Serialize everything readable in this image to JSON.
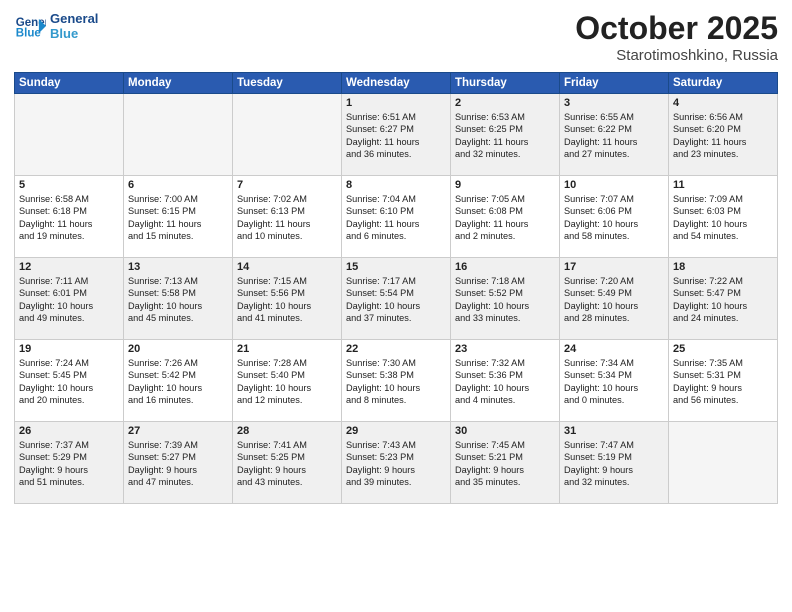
{
  "header": {
    "logo_line1": "General",
    "logo_line2": "Blue",
    "month": "October 2025",
    "location": "Starotimoshkino, Russia"
  },
  "days_of_week": [
    "Sunday",
    "Monday",
    "Tuesday",
    "Wednesday",
    "Thursday",
    "Friday",
    "Saturday"
  ],
  "weeks": [
    [
      {
        "day": "",
        "info": "",
        "empty": true
      },
      {
        "day": "",
        "info": "",
        "empty": true
      },
      {
        "day": "",
        "info": "",
        "empty": true
      },
      {
        "day": "1",
        "info": "Sunrise: 6:51 AM\nSunset: 6:27 PM\nDaylight: 11 hours\nand 36 minutes."
      },
      {
        "day": "2",
        "info": "Sunrise: 6:53 AM\nSunset: 6:25 PM\nDaylight: 11 hours\nand 32 minutes."
      },
      {
        "day": "3",
        "info": "Sunrise: 6:55 AM\nSunset: 6:22 PM\nDaylight: 11 hours\nand 27 minutes."
      },
      {
        "day": "4",
        "info": "Sunrise: 6:56 AM\nSunset: 6:20 PM\nDaylight: 11 hours\nand 23 minutes."
      }
    ],
    [
      {
        "day": "5",
        "info": "Sunrise: 6:58 AM\nSunset: 6:18 PM\nDaylight: 11 hours\nand 19 minutes."
      },
      {
        "day": "6",
        "info": "Sunrise: 7:00 AM\nSunset: 6:15 PM\nDaylight: 11 hours\nand 15 minutes."
      },
      {
        "day": "7",
        "info": "Sunrise: 7:02 AM\nSunset: 6:13 PM\nDaylight: 11 hours\nand 10 minutes."
      },
      {
        "day": "8",
        "info": "Sunrise: 7:04 AM\nSunset: 6:10 PM\nDaylight: 11 hours\nand 6 minutes."
      },
      {
        "day": "9",
        "info": "Sunrise: 7:05 AM\nSunset: 6:08 PM\nDaylight: 11 hours\nand 2 minutes."
      },
      {
        "day": "10",
        "info": "Sunrise: 7:07 AM\nSunset: 6:06 PM\nDaylight: 10 hours\nand 58 minutes."
      },
      {
        "day": "11",
        "info": "Sunrise: 7:09 AM\nSunset: 6:03 PM\nDaylight: 10 hours\nand 54 minutes."
      }
    ],
    [
      {
        "day": "12",
        "info": "Sunrise: 7:11 AM\nSunset: 6:01 PM\nDaylight: 10 hours\nand 49 minutes."
      },
      {
        "day": "13",
        "info": "Sunrise: 7:13 AM\nSunset: 5:58 PM\nDaylight: 10 hours\nand 45 minutes."
      },
      {
        "day": "14",
        "info": "Sunrise: 7:15 AM\nSunset: 5:56 PM\nDaylight: 10 hours\nand 41 minutes."
      },
      {
        "day": "15",
        "info": "Sunrise: 7:17 AM\nSunset: 5:54 PM\nDaylight: 10 hours\nand 37 minutes."
      },
      {
        "day": "16",
        "info": "Sunrise: 7:18 AM\nSunset: 5:52 PM\nDaylight: 10 hours\nand 33 minutes."
      },
      {
        "day": "17",
        "info": "Sunrise: 7:20 AM\nSunset: 5:49 PM\nDaylight: 10 hours\nand 28 minutes."
      },
      {
        "day": "18",
        "info": "Sunrise: 7:22 AM\nSunset: 5:47 PM\nDaylight: 10 hours\nand 24 minutes."
      }
    ],
    [
      {
        "day": "19",
        "info": "Sunrise: 7:24 AM\nSunset: 5:45 PM\nDaylight: 10 hours\nand 20 minutes."
      },
      {
        "day": "20",
        "info": "Sunrise: 7:26 AM\nSunset: 5:42 PM\nDaylight: 10 hours\nand 16 minutes."
      },
      {
        "day": "21",
        "info": "Sunrise: 7:28 AM\nSunset: 5:40 PM\nDaylight: 10 hours\nand 12 minutes."
      },
      {
        "day": "22",
        "info": "Sunrise: 7:30 AM\nSunset: 5:38 PM\nDaylight: 10 hours\nand 8 minutes."
      },
      {
        "day": "23",
        "info": "Sunrise: 7:32 AM\nSunset: 5:36 PM\nDaylight: 10 hours\nand 4 minutes."
      },
      {
        "day": "24",
        "info": "Sunrise: 7:34 AM\nSunset: 5:34 PM\nDaylight: 10 hours\nand 0 minutes."
      },
      {
        "day": "25",
        "info": "Sunrise: 7:35 AM\nSunset: 5:31 PM\nDaylight: 9 hours\nand 56 minutes."
      }
    ],
    [
      {
        "day": "26",
        "info": "Sunrise: 7:37 AM\nSunset: 5:29 PM\nDaylight: 9 hours\nand 51 minutes."
      },
      {
        "day": "27",
        "info": "Sunrise: 7:39 AM\nSunset: 5:27 PM\nDaylight: 9 hours\nand 47 minutes."
      },
      {
        "day": "28",
        "info": "Sunrise: 7:41 AM\nSunset: 5:25 PM\nDaylight: 9 hours\nand 43 minutes."
      },
      {
        "day": "29",
        "info": "Sunrise: 7:43 AM\nSunset: 5:23 PM\nDaylight: 9 hours\nand 39 minutes."
      },
      {
        "day": "30",
        "info": "Sunrise: 7:45 AM\nSunset: 5:21 PM\nDaylight: 9 hours\nand 35 minutes."
      },
      {
        "day": "31",
        "info": "Sunrise: 7:47 AM\nSunset: 5:19 PM\nDaylight: 9 hours\nand 32 minutes."
      },
      {
        "day": "",
        "info": "",
        "empty": true
      }
    ]
  ]
}
